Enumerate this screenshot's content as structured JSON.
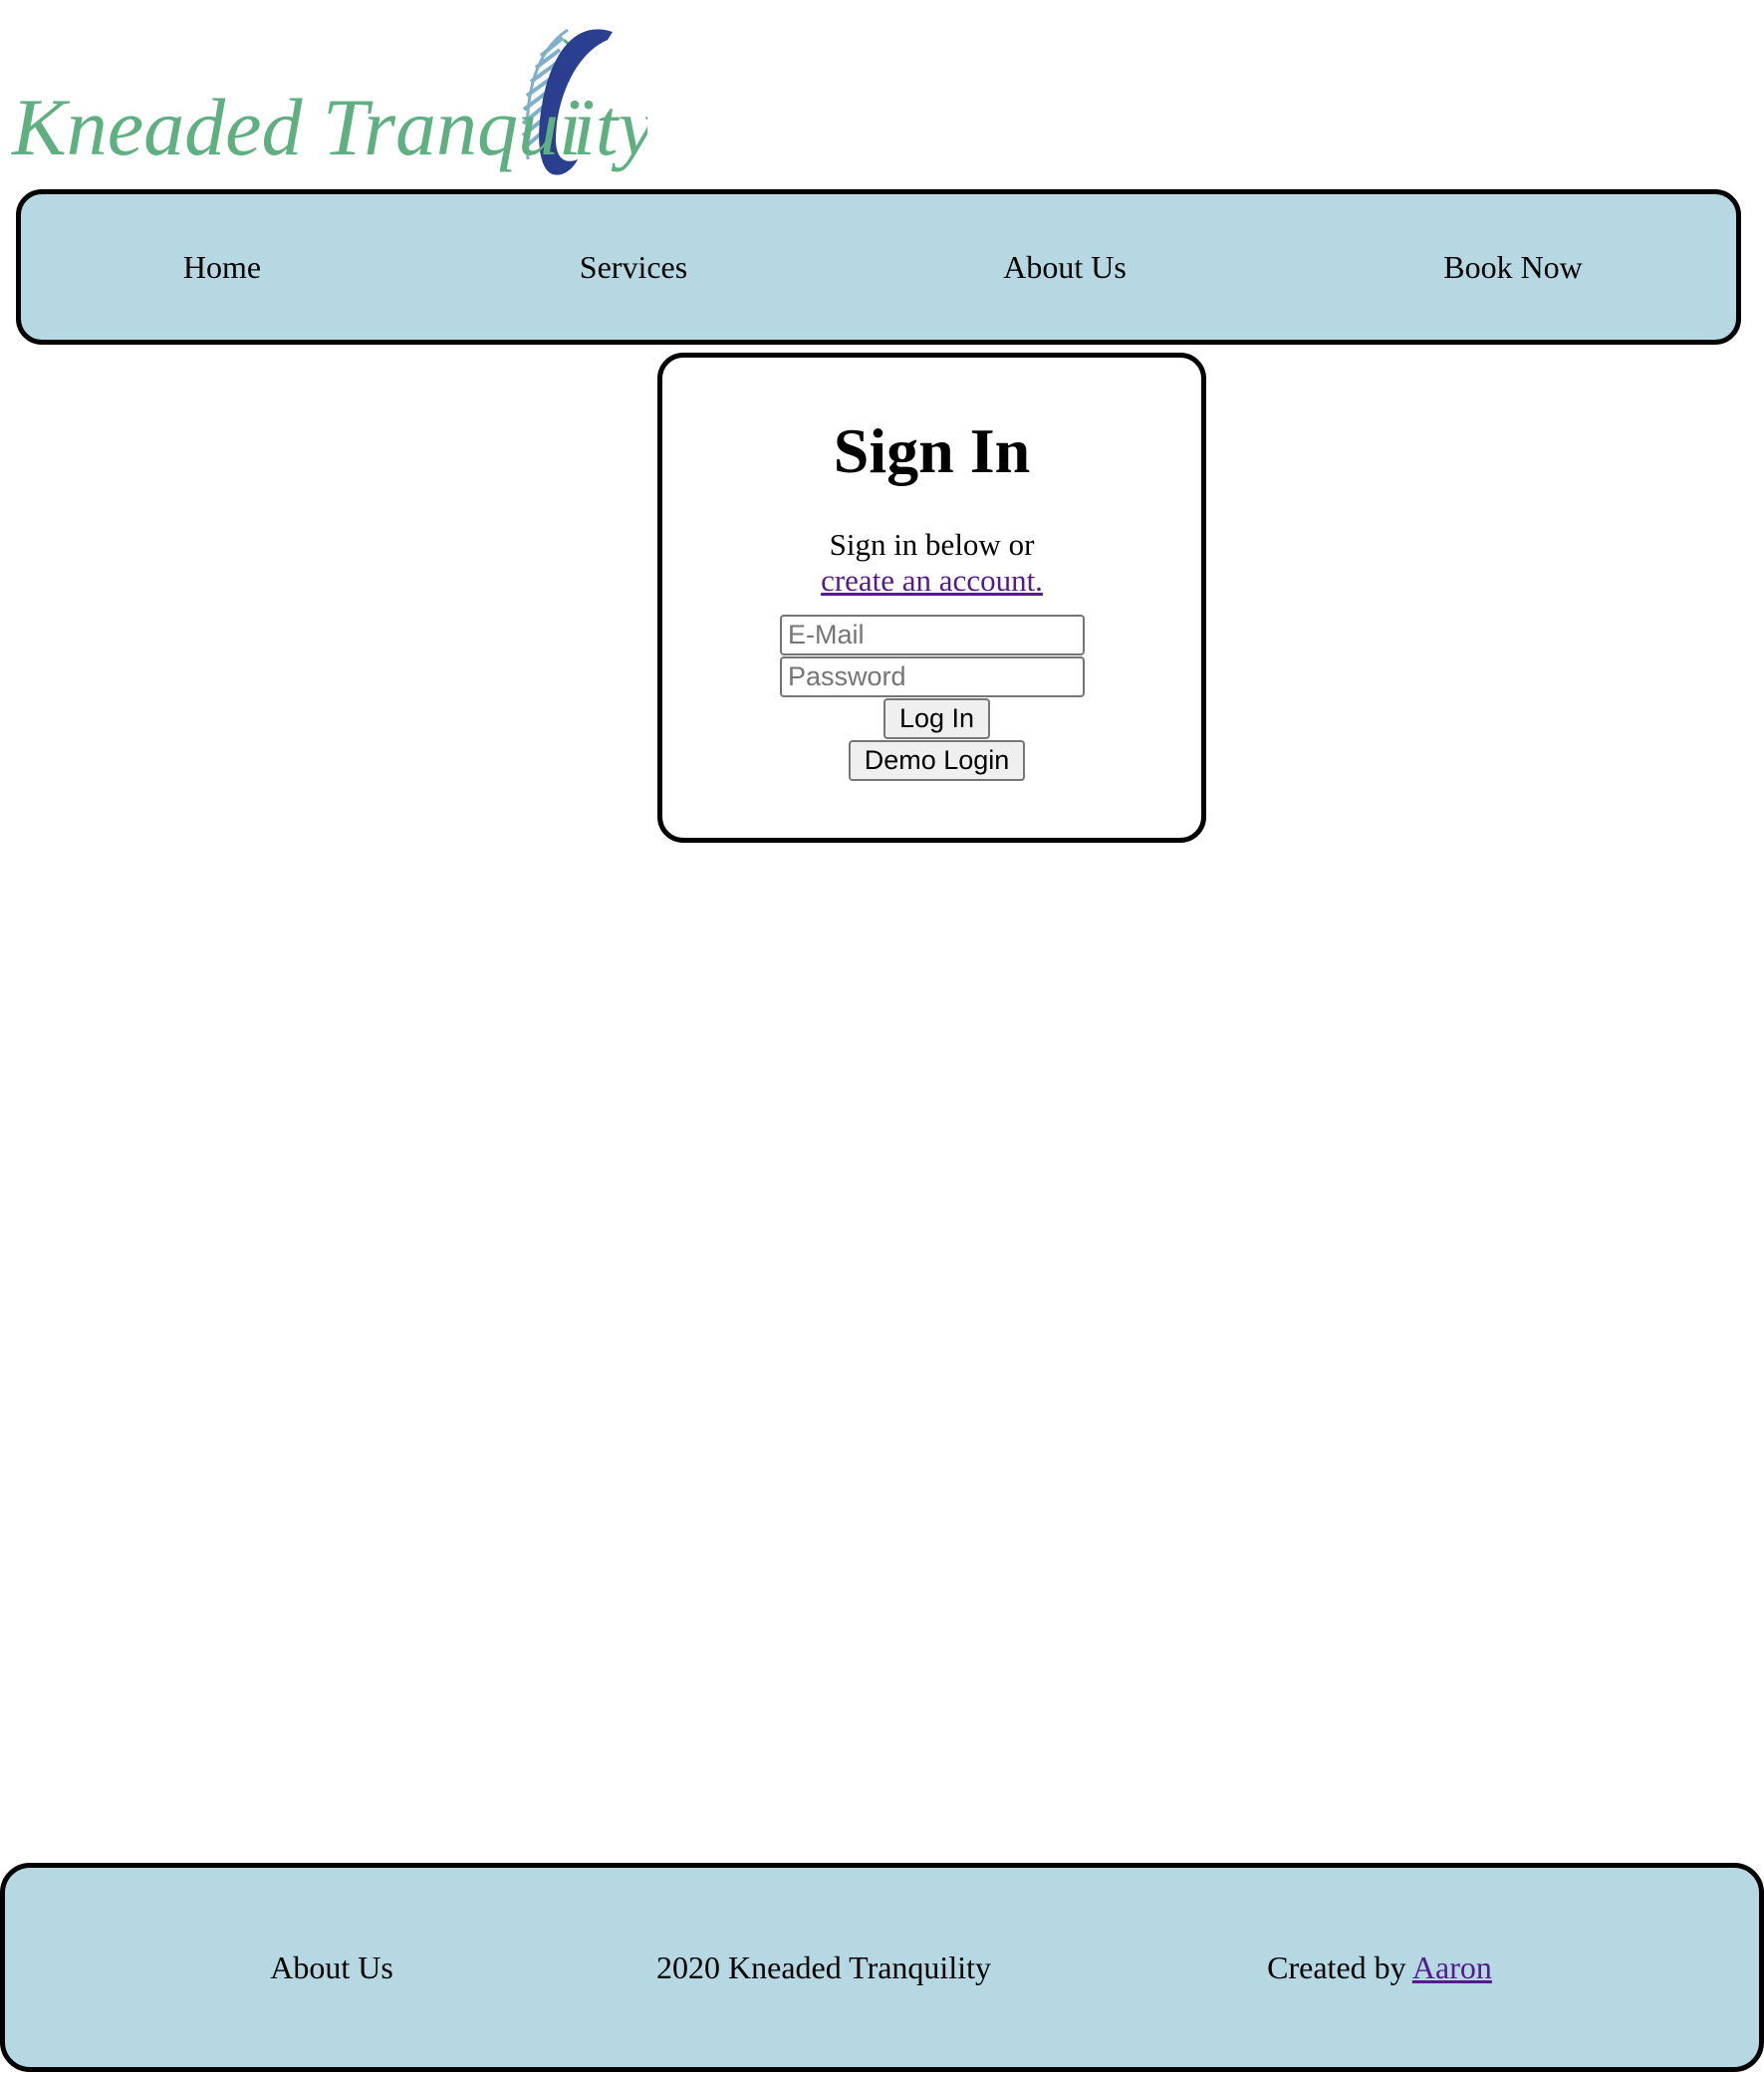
{
  "logo": {
    "text_part1": "Kneaded Tranqui",
    "text_part2": "ity",
    "colors": {
      "text": "#5fb080",
      "swoosh": "#2a3f8f",
      "leaf": "#7fb0c8"
    }
  },
  "nav": {
    "items": [
      {
        "label": "Home"
      },
      {
        "label": "Services"
      },
      {
        "label": "About Us"
      },
      {
        "label": "Book Now"
      }
    ]
  },
  "signin": {
    "title": "Sign In",
    "subtitle": "Sign in below or",
    "create_account_link": "create an account.",
    "email_placeholder": "E-Mail",
    "password_placeholder": "Password",
    "login_button": "Log In",
    "demo_button": "Demo Login"
  },
  "footer": {
    "about_label": "About Us",
    "copyright": "2020 Kneaded Tranquility",
    "created_by_prefix": "Created by",
    "created_by_link": "Aaron"
  },
  "colors": {
    "bar_background": "#b5d8e3",
    "border": "#000000",
    "visited_link": "#551a8b"
  }
}
